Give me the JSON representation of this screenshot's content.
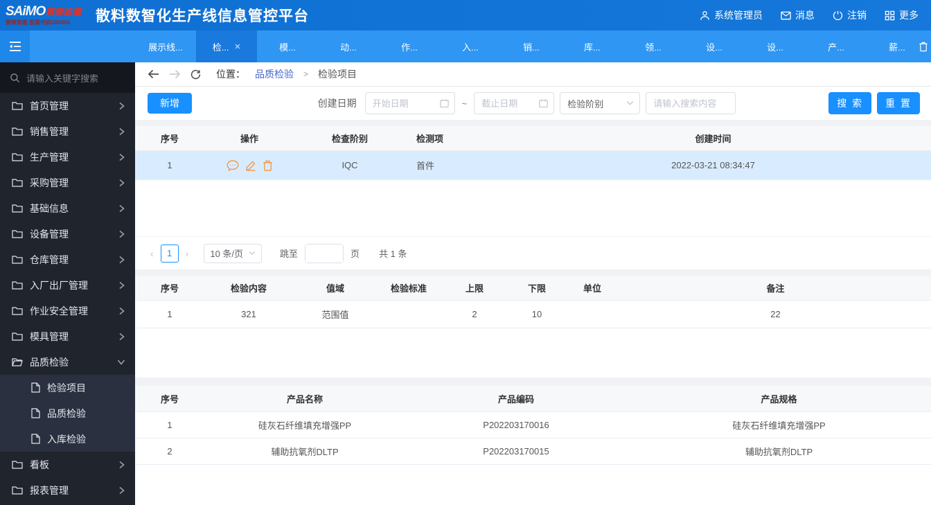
{
  "header": {
    "logo": {
      "brand_en": "SAiMO",
      "brand_cn": "赛摩雄鹰",
      "subtitle": "赛摩智能 股票代码300466"
    },
    "title": "散料数智化生产线信息管控平台",
    "user_label": "系统管理员",
    "messages_label": "消息",
    "logout_label": "注销",
    "more_label": "更多"
  },
  "tabs": {
    "items": [
      {
        "label": "展示线..."
      },
      {
        "label": "检...",
        "active": true
      },
      {
        "label": "模..."
      },
      {
        "label": "动..."
      },
      {
        "label": "作..."
      },
      {
        "label": "入..."
      },
      {
        "label": "销..."
      },
      {
        "label": "库..."
      },
      {
        "label": "领..."
      },
      {
        "label": "设..."
      },
      {
        "label": "设..."
      },
      {
        "label": "产..."
      },
      {
        "label": "薪..."
      }
    ],
    "close_glyph": "×"
  },
  "sidebar": {
    "search_placeholder": "请输入关键字搜索",
    "items": [
      {
        "label": "首页管理"
      },
      {
        "label": "销售管理"
      },
      {
        "label": "生产管理"
      },
      {
        "label": "采购管理"
      },
      {
        "label": "基础信息"
      },
      {
        "label": "设备管理"
      },
      {
        "label": "仓库管理"
      },
      {
        "label": "入厂出厂管理"
      },
      {
        "label": "作业安全管理"
      },
      {
        "label": "模具管理"
      },
      {
        "label": "品质检验",
        "expanded": true
      },
      {
        "label": "看板"
      },
      {
        "label": "报表管理"
      }
    ],
    "submenu": [
      "检验项目",
      "品质检验",
      "入库检验"
    ]
  },
  "breadcrumb": {
    "location_label": "位置：",
    "parent": "品质检验",
    "separator": ">",
    "current": "检验项目"
  },
  "toolbar": {
    "add_label": "新增",
    "date_label": "创建日期",
    "start_placeholder": "开始日期",
    "tilde": "~",
    "end_placeholder": "截止日期",
    "stage_placeholder": "检验阶别",
    "keyword_placeholder": "请输入搜索内容",
    "search_label": "搜 索",
    "reset_label": "重 置"
  },
  "table1": {
    "headers": [
      "序号",
      "操作",
      "检查阶别",
      "检测项",
      "创建时间"
    ],
    "rows": [
      {
        "seq": "1",
        "stage": "IQC",
        "item": "首件",
        "created": "2022-03-21 08:34:47"
      }
    ]
  },
  "pagination": {
    "prev": "‹",
    "page": "1",
    "next": "›",
    "page_size": "10 条/页",
    "jump_label": "跳至",
    "page_unit": "页",
    "total": "共 1 条"
  },
  "table2": {
    "headers": [
      "序号",
      "检验内容",
      "值域",
      "检验标准",
      "上限",
      "下限",
      "单位",
      "备注"
    ],
    "rows": [
      {
        "seq": "1",
        "content": "321",
        "range_type": "范围值",
        "standard": "",
        "upper": "2",
        "lower": "10",
        "unit": "",
        "remark": "22"
      }
    ]
  },
  "table3": {
    "headers": [
      "序号",
      "产品名称",
      "产品编码",
      "产品规格"
    ],
    "rows": [
      {
        "seq": "1",
        "name": "硅灰石纤维填充增强PP",
        "code": "P202203170016",
        "spec": "硅灰石纤维填充增强PP"
      },
      {
        "seq": "2",
        "name": "辅助抗氧剂DLTP",
        "code": "P202203170015",
        "spec": "辅助抗氧剂DLTP"
      }
    ]
  },
  "colors": {
    "header_blue": "#1375d8",
    "tabbar_blue": "#2f96f3",
    "active_tab_blue": "#1979dd",
    "accent_blue": "#1890ff",
    "selected_row": "#d9ecff",
    "action_icon_orange": "#f09b4c",
    "sidebar_dark": "#20242d",
    "submenu_dark": "#2a3040"
  }
}
